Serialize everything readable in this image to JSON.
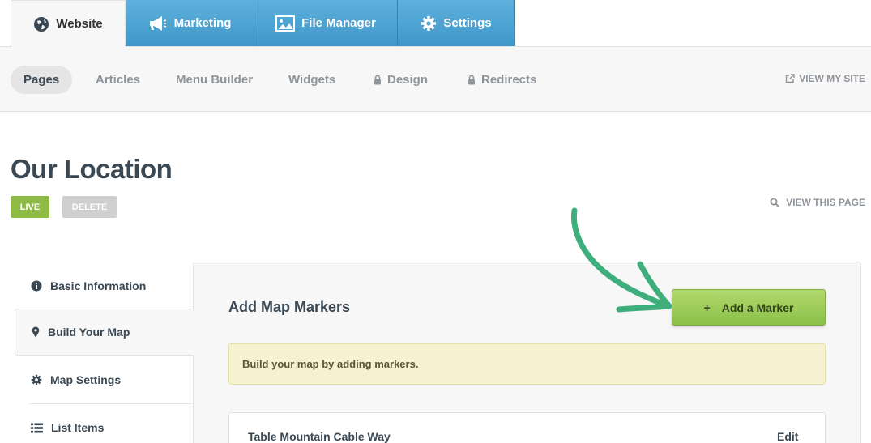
{
  "top_tabs": [
    {
      "label": "Website",
      "icon": "globe-icon",
      "active": true
    },
    {
      "label": "Marketing",
      "icon": "megaphone-icon",
      "active": false
    },
    {
      "label": "File Manager",
      "icon": "image-icon",
      "active": false
    },
    {
      "label": "Settings",
      "icon": "gear-icon",
      "active": false
    }
  ],
  "subnav": {
    "items": [
      {
        "label": "Pages",
        "active": true,
        "locked": false
      },
      {
        "label": "Articles",
        "active": false,
        "locked": false
      },
      {
        "label": "Menu Builder",
        "active": false,
        "locked": false
      },
      {
        "label": "Widgets",
        "active": false,
        "locked": false
      },
      {
        "label": "Design",
        "active": false,
        "locked": true
      },
      {
        "label": "Redirects",
        "active": false,
        "locked": true
      }
    ],
    "view_site": "VIEW MY SITE"
  },
  "header": {
    "title": "Our Location",
    "live_label": "LIVE",
    "delete_label": "DELETE",
    "view_page": "VIEW THIS PAGE"
  },
  "side_menu": [
    {
      "label": "Basic Information",
      "icon": "info-icon",
      "active": false
    },
    {
      "label": "Build Your Map",
      "icon": "map-pin-icon",
      "active": true
    },
    {
      "label": "Map Settings",
      "icon": "gear-icon",
      "active": false
    },
    {
      "label": "List Items",
      "icon": "list-icon",
      "active": false
    }
  ],
  "panel": {
    "title": "Add Map Markers",
    "add_button": "Add a Marker",
    "add_symbol": "+",
    "notice": "Build your map by adding markers.",
    "markers": [
      {
        "name": "Table Mountain Cable Way",
        "edit_label": "Edit"
      }
    ]
  },
  "colors": {
    "tab_blue": "#4aa3d3",
    "live_green": "#8dbb46",
    "button_green": "#9ccb58",
    "arrow_green": "#3fae7d",
    "text_dark": "#3a4853"
  }
}
